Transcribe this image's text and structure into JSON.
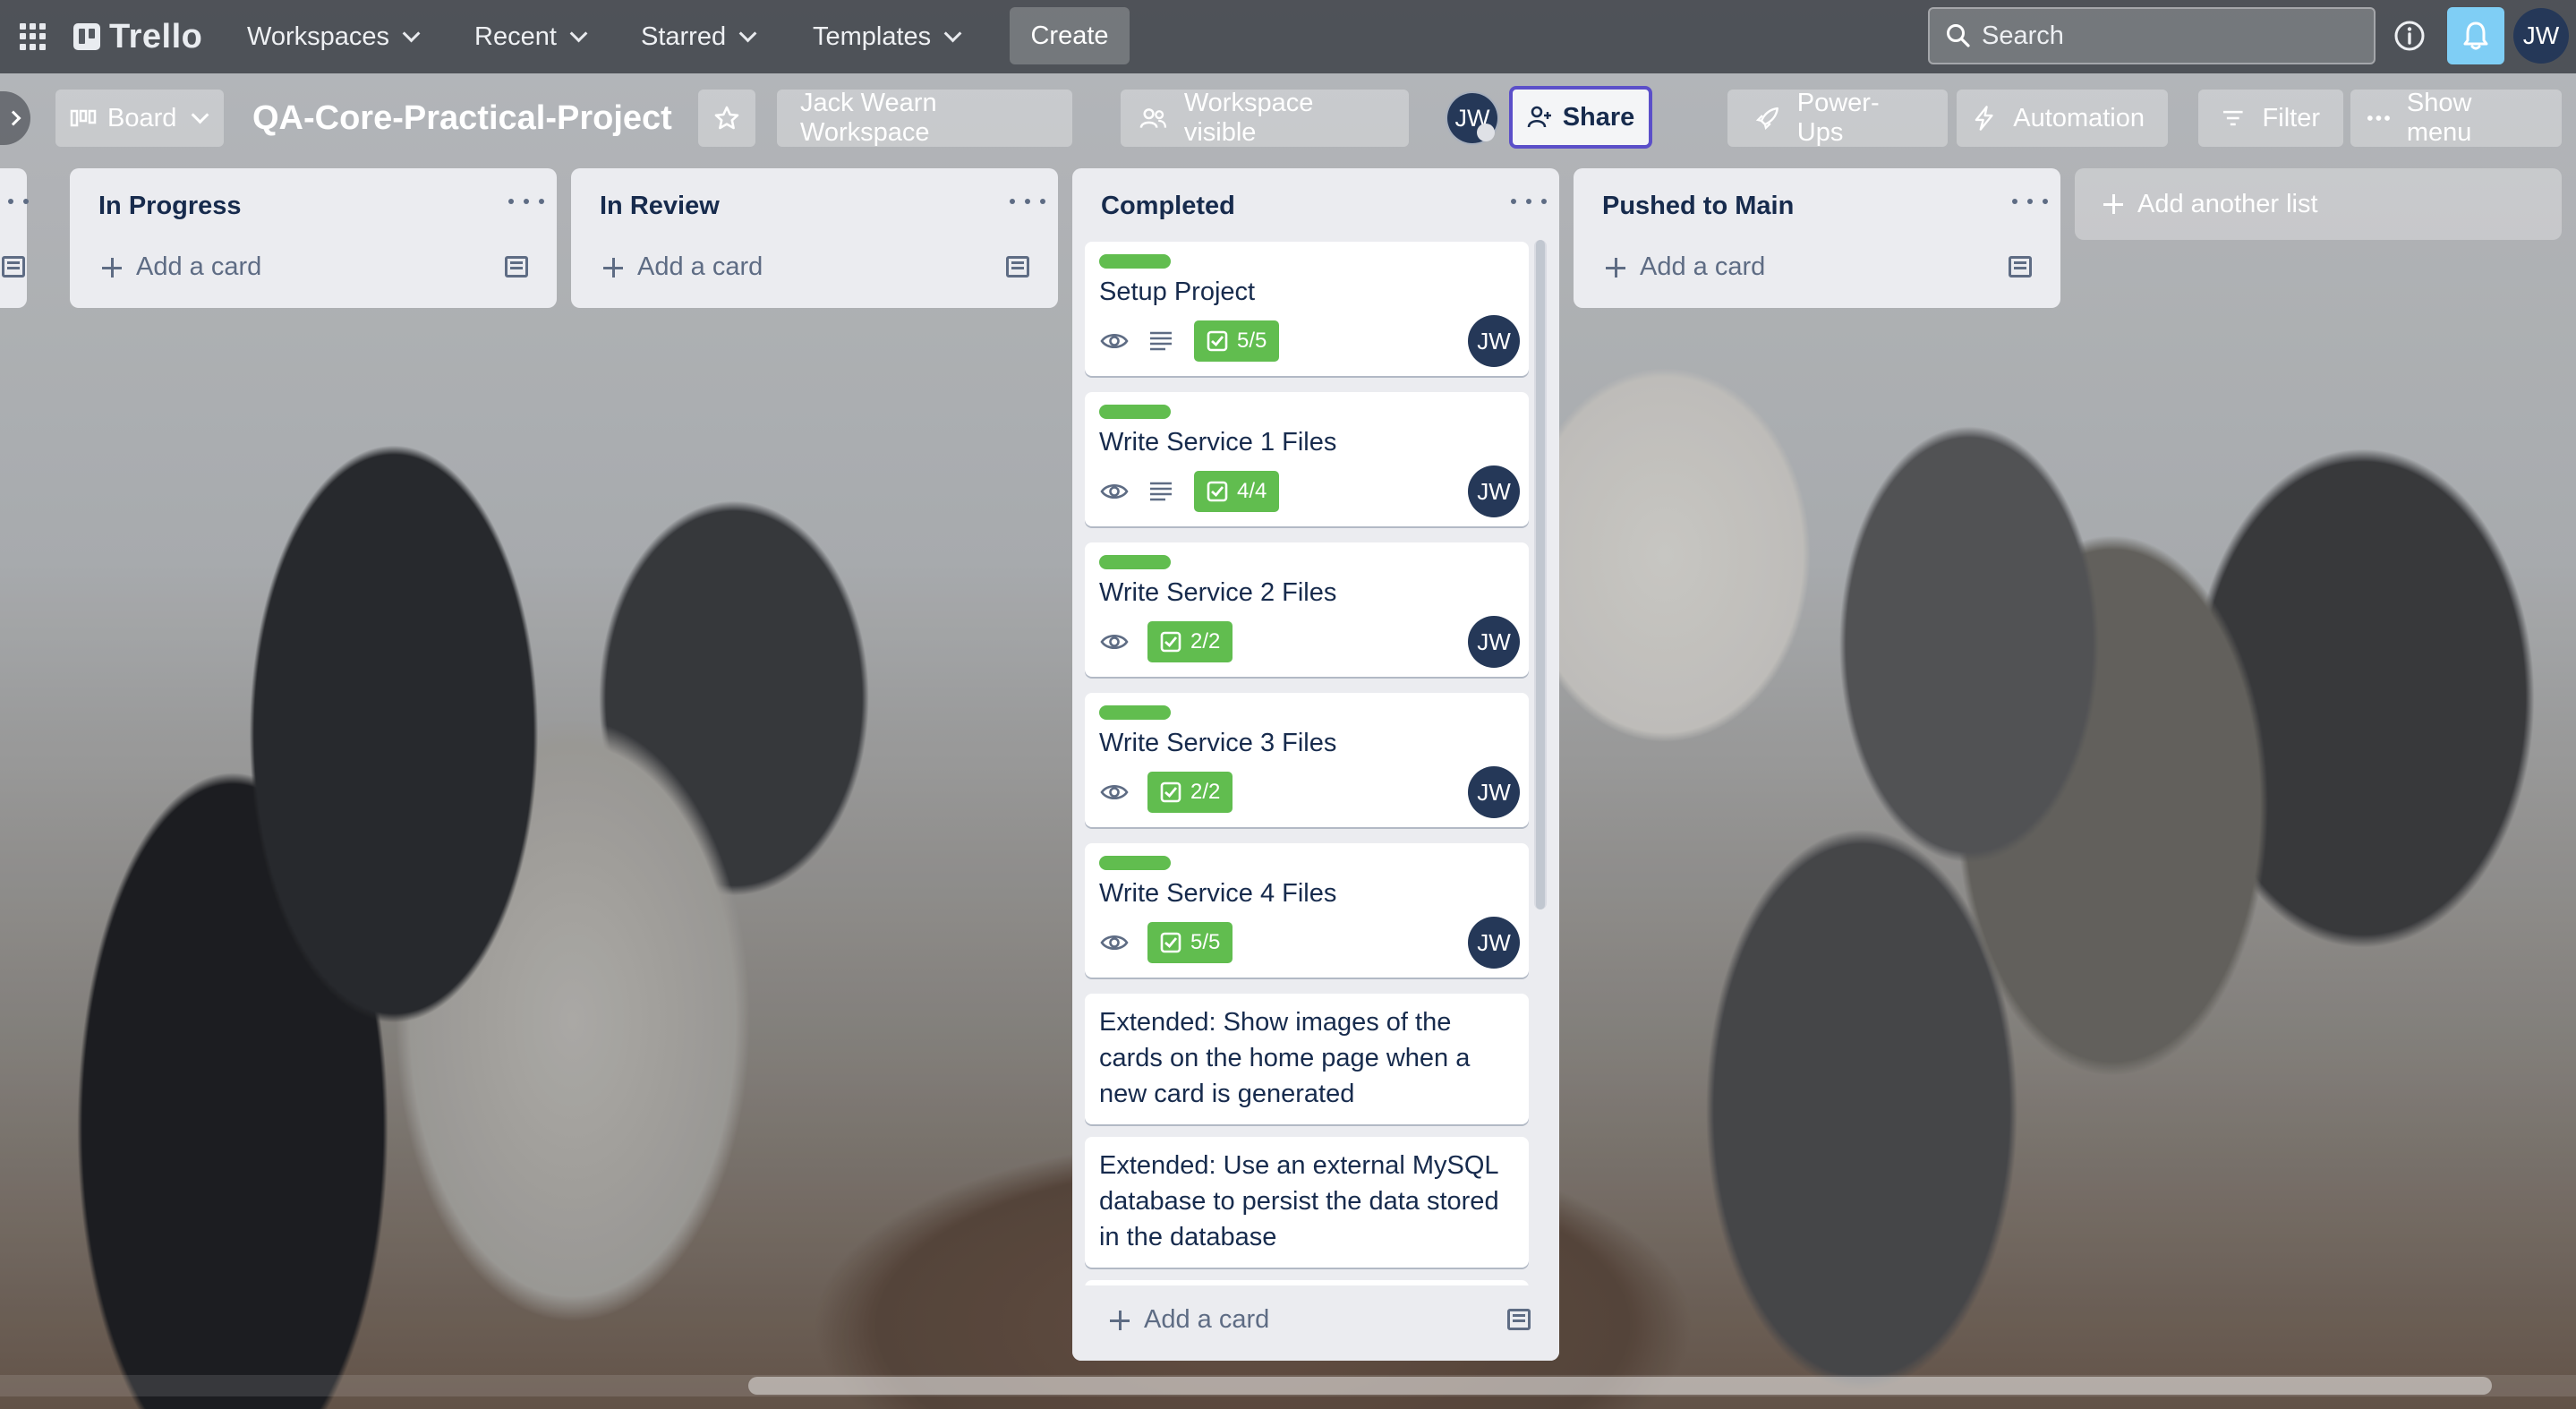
{
  "header": {
    "app_name": "Trello",
    "menus": [
      "Workspaces",
      "Recent",
      "Starred",
      "Templates"
    ],
    "create_label": "Create",
    "search_placeholder": "Search",
    "user_initials": "JW"
  },
  "board": {
    "view_label": "Board",
    "title": "QA-Core-Practical-Project",
    "workspace_label": "Jack Wearn Workspace",
    "visibility_label": "Workspace visible",
    "member_initials": "JW",
    "share_label": "Share",
    "powerups_label": "Power-Ups",
    "automation_label": "Automation",
    "filter_label": "Filter",
    "show_menu_label": "Show menu",
    "add_list_label": "Add another list"
  },
  "lists": [
    {
      "title": "In Progress",
      "add_card_label": "Add a card"
    },
    {
      "title": "In Review",
      "add_card_label": "Add a card"
    },
    {
      "title": "Completed",
      "add_card_label": "Add a card",
      "cards": [
        {
          "title": "Setup Project",
          "checklist": "5/5",
          "has_description": true,
          "member": "JW"
        },
        {
          "title": "Write Service 1 Files",
          "checklist": "4/4",
          "has_description": true,
          "member": "JW"
        },
        {
          "title": "Write Service 2 Files",
          "checklist": "2/2",
          "has_description": false,
          "member": "JW"
        },
        {
          "title": "Write Service 3 Files",
          "checklist": "2/2",
          "has_description": false,
          "member": "JW"
        },
        {
          "title": "Write Service 4 Files",
          "checklist": "5/5",
          "has_description": false,
          "member": "JW"
        },
        {
          "title_lines": [
            "Extended: Show images of the",
            "cards on the home page when a",
            "new card is generated"
          ]
        },
        {
          "title_lines": [
            "Extended: Use an external MySQL",
            "database to persist the data stored",
            "in the database"
          ]
        }
      ]
    },
    {
      "title": "Pushed to Main",
      "add_card_label": "Add a card"
    }
  ],
  "colors": {
    "label_green": "#61bd4f",
    "avatar_navy": "#253858",
    "list_bg": "#ebecf0",
    "notification_blue": "#7fcef5",
    "share_border": "#5b4fc9"
  },
  "icons": [
    "apps-grid-icon",
    "trello-logo-icon",
    "chevron-down-icon",
    "search-icon",
    "info-icon",
    "bell-icon",
    "board-view-icon",
    "star-icon",
    "people-icon",
    "add-member-icon",
    "rocket-icon",
    "lightning-icon",
    "filter-icon",
    "more-dots-icon",
    "plus-icon",
    "card-template-icon",
    "eye-icon",
    "description-icon",
    "checklist-icon"
  ]
}
